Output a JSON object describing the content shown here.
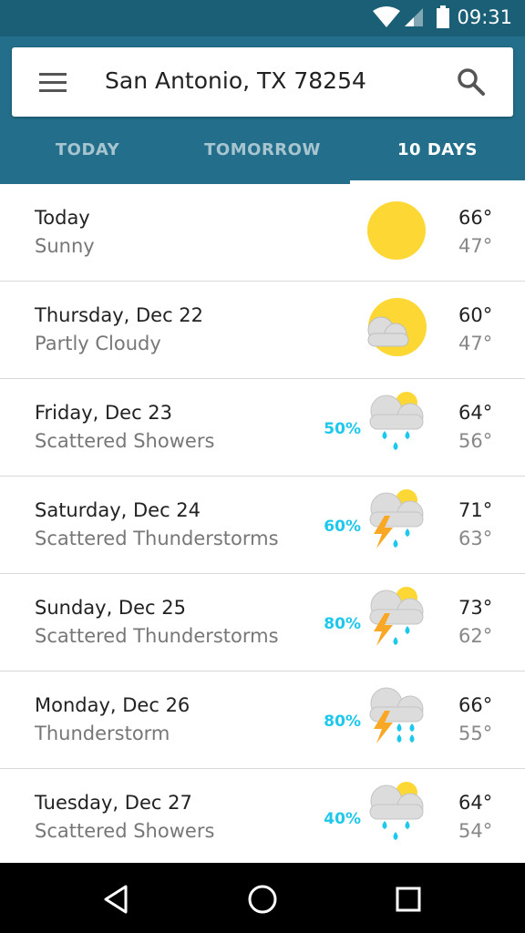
{
  "status_bar": {
    "time": "09:31"
  },
  "search": {
    "location": "San Antonio, TX 78254"
  },
  "tabs": [
    {
      "label": "TODAY",
      "active": false
    },
    {
      "label": "TOMORROW",
      "active": false
    },
    {
      "label": "10 DAYS",
      "active": true
    }
  ],
  "forecast": [
    {
      "day": "Today",
      "condition": "Sunny",
      "precip": "",
      "high": "66°",
      "low": "47°",
      "icon": "sunny-icon"
    },
    {
      "day": "Thursday, Dec 22",
      "condition": "Partly Cloudy",
      "precip": "",
      "high": "60°",
      "low": "47°",
      "icon": "partly-cloudy-icon"
    },
    {
      "day": "Friday, Dec 23",
      "condition": "Scattered Showers",
      "precip": "50%",
      "high": "64°",
      "low": "56°",
      "icon": "scattered-showers-icon"
    },
    {
      "day": "Saturday, Dec 24",
      "condition": "Scattered Thunderstorms",
      "precip": "60%",
      "high": "71°",
      "low": "63°",
      "icon": "scattered-thunderstorms-icon"
    },
    {
      "day": "Sunday, Dec 25",
      "condition": "Scattered Thunderstorms",
      "precip": "80%",
      "high": "73°",
      "low": "62°",
      "icon": "scattered-thunderstorms-icon"
    },
    {
      "day": "Monday, Dec 26",
      "condition": "Thunderstorm",
      "precip": "80%",
      "high": "66°",
      "low": "55°",
      "icon": "thunderstorm-icon"
    },
    {
      "day": "Tuesday, Dec 27",
      "condition": "Scattered Showers",
      "precip": "40%",
      "high": "64°",
      "low": "54°",
      "icon": "scattered-showers-icon"
    }
  ],
  "colors": {
    "app_bar": "#236e8a",
    "status_bar": "#1b5f77",
    "precip_accent": "#1ec8ec",
    "sun": "#fdd835",
    "bolt": "#f9a825"
  },
  "nav_icons": [
    "back-icon",
    "home-icon",
    "recents-icon"
  ]
}
